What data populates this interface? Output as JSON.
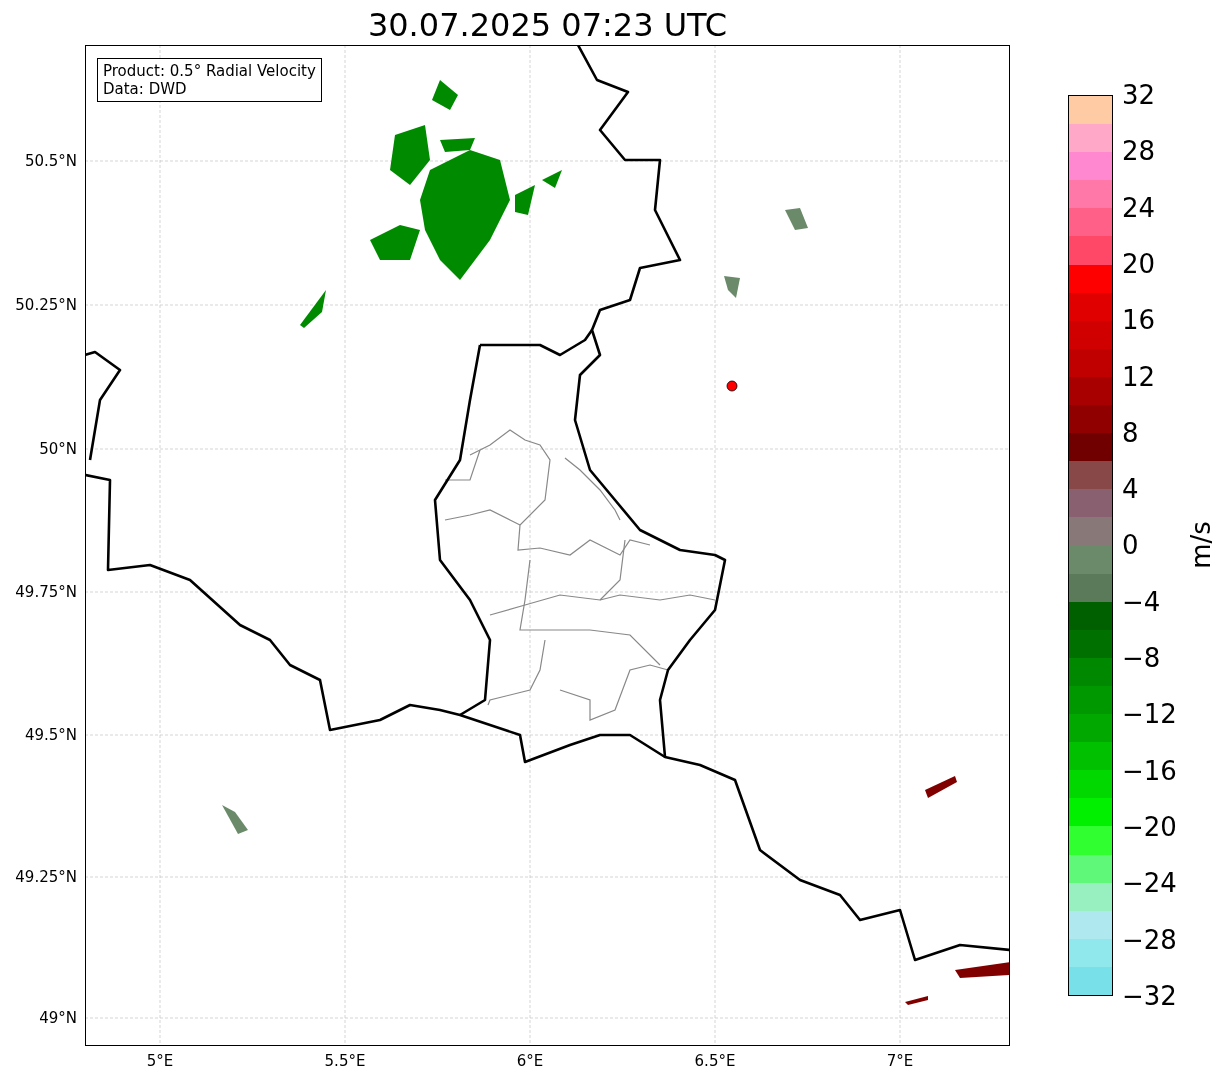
{
  "title": "30.07.2025 07:23 UTC",
  "legend": {
    "lines": [
      "Product: 0.5° Radial Velocity",
      "Data: DWD"
    ]
  },
  "y_ticks": [
    "50.5°N",
    "50.25°N",
    "50°N",
    "49.75°N",
    "49.5°N",
    "49.25°N",
    "49°N"
  ],
  "x_ticks": [
    "5°E",
    "5.5°E",
    "6°E",
    "6.5°E",
    "7°E"
  ],
  "colorbar": {
    "label": "m/s",
    "ticks": [
      "32",
      "28",
      "24",
      "20",
      "16",
      "12",
      "8",
      "4",
      "0",
      "−4",
      "−8",
      "−12",
      "−16",
      "−20",
      "−24",
      "−28",
      "−32"
    ],
    "segments": [
      {
        "color": "#ffcba4"
      },
      {
        "color": "#ffa8c8"
      },
      {
        "color": "#ff88d0"
      },
      {
        "color": "#ff78a8"
      },
      {
        "color": "#ff6088"
      },
      {
        "color": "#ff4868"
      },
      {
        "color": "#ff0000"
      },
      {
        "color": "#e00000"
      },
      {
        "color": "#d00000"
      },
      {
        "color": "#c00000"
      },
      {
        "color": "#a80000"
      },
      {
        "color": "#900000"
      },
      {
        "color": "#700000"
      },
      {
        "color": "#884848"
      },
      {
        "color": "#886070"
      },
      {
        "color": "#887878"
      },
      {
        "color": "#6a8a6a"
      },
      {
        "color": "#5a7a5a"
      },
      {
        "color": "#006000"
      },
      {
        "color": "#007000"
      },
      {
        "color": "#008800"
      },
      {
        "color": "#009800"
      },
      {
        "color": "#00a800"
      },
      {
        "color": "#00c000"
      },
      {
        "color": "#00d800"
      },
      {
        "color": "#00f000"
      },
      {
        "color": "#30ff30"
      },
      {
        "color": "#60f878"
      },
      {
        "color": "#98f0c0"
      },
      {
        "color": "#b0e8f0"
      },
      {
        "color": "#90e8ec"
      },
      {
        "color": "#78e0e8"
      }
    ]
  }
}
